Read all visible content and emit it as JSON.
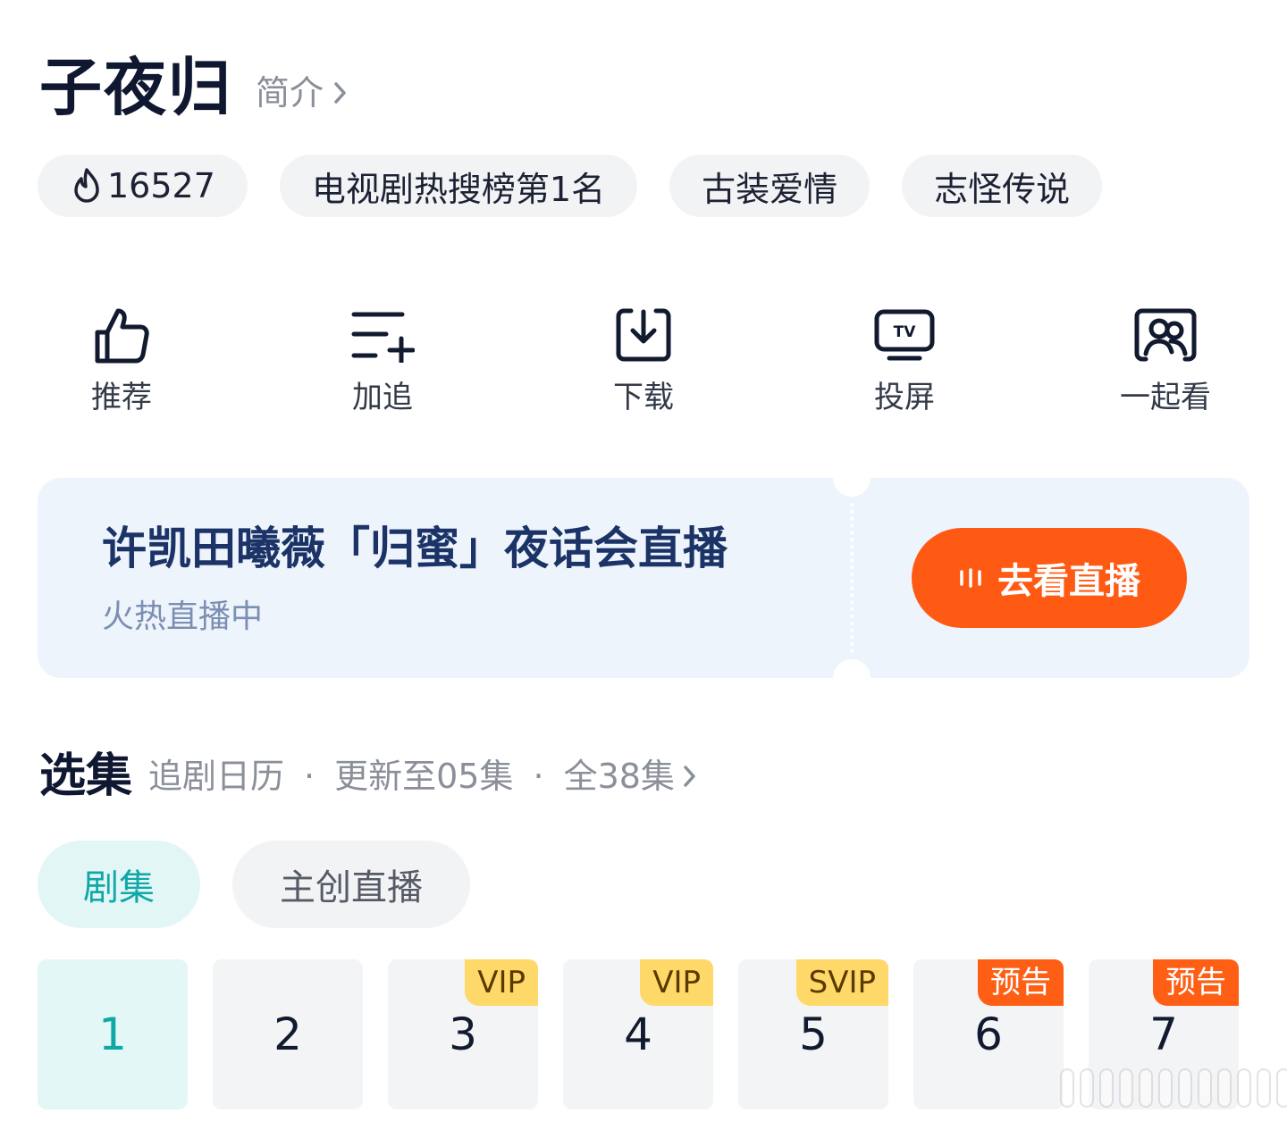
{
  "header": {
    "title": "子夜归",
    "intro_label": "简介"
  },
  "tags": {
    "heat_value": "16527",
    "items": [
      "电视剧热搜榜第1名",
      "古装爱情",
      "志怪传说"
    ]
  },
  "actions": [
    {
      "label": "推荐",
      "icon": "thumbs-up-icon"
    },
    {
      "label": "加追",
      "icon": "add-to-list-icon"
    },
    {
      "label": "下载",
      "icon": "download-icon"
    },
    {
      "label": "投屏",
      "icon": "tv-cast-icon"
    },
    {
      "label": "一起看",
      "icon": "watch-together-icon"
    }
  ],
  "live": {
    "title": "许凯田曦薇「归蜜」夜话会直播",
    "subtitle": "火热直播中",
    "button_label": "去看直播"
  },
  "episodes_section": {
    "title": "选集",
    "calendar": "追剧日历",
    "separator": "·",
    "updated": "更新至05集",
    "total": "全38集"
  },
  "episode_tabs": {
    "active": "剧集",
    "inactive": "主创直播"
  },
  "episodes": [
    {
      "num": "1",
      "badge": ""
    },
    {
      "num": "2",
      "badge": ""
    },
    {
      "num": "3",
      "badge": "VIP"
    },
    {
      "num": "4",
      "badge": "VIP"
    },
    {
      "num": "5",
      "badge": "SVIP"
    },
    {
      "num": "6",
      "badge": "预告"
    },
    {
      "num": "7",
      "badge": "预告"
    }
  ],
  "colors": {
    "accent_teal": "#10a7a7",
    "live_orange": "#ff5a13",
    "vip_gold": "#ffd86a",
    "preview_orange": "#ff5f14",
    "live_card_bg": "#eef4fc"
  }
}
